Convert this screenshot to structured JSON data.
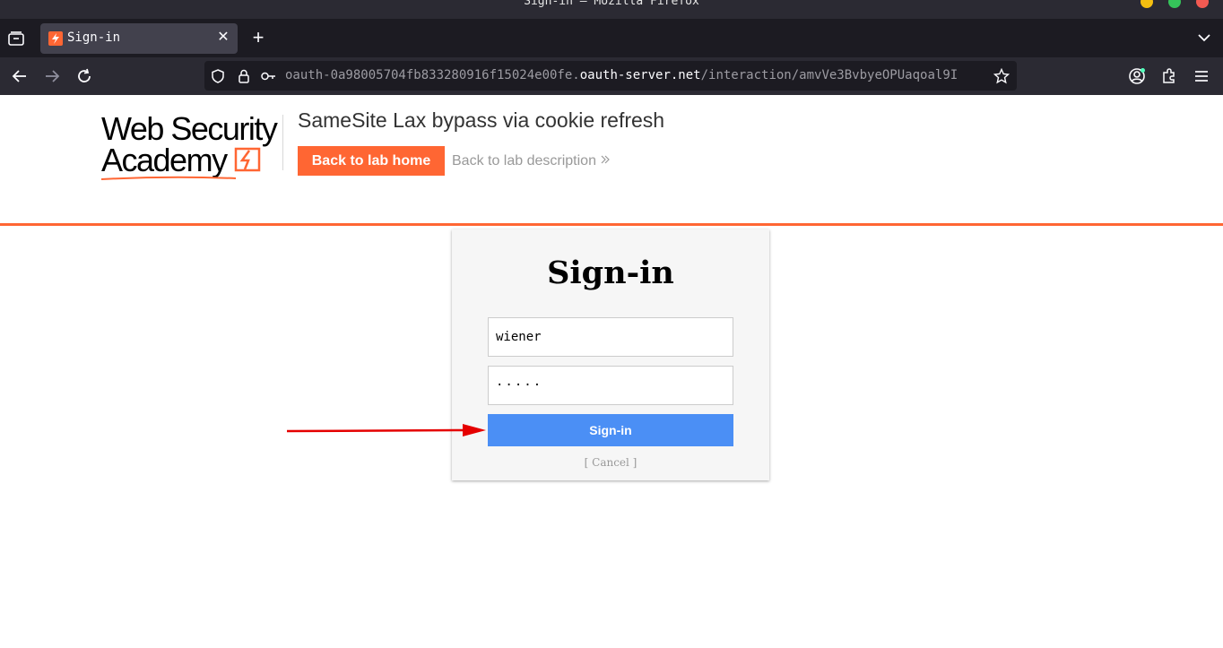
{
  "window": {
    "title": "Sign-in — Mozilla Firefox"
  },
  "tabs": [
    {
      "title": "Sign-in",
      "icon": "lightning-favicon-icon",
      "active": true
    }
  ],
  "urlbar": {
    "url_prefix": "oauth-0a98005704fb833280916f15024e00fe.",
    "url_domain": "oauth-server.net",
    "url_path": "/interaction/amvVe3BvbyeOPUaqoal9I"
  },
  "header": {
    "logo_line1": "Web Security",
    "logo_line2": "Academy",
    "lab_title": "SameSite Lax bypass via cookie refresh",
    "back_home_label": "Back to lab home",
    "back_description_label": "Back to lab description",
    "accent_color": "#ff6633"
  },
  "login": {
    "heading": "Sign-in",
    "username_value": "wiener",
    "password_value": "·····",
    "submit_label": "Sign-in",
    "cancel_label": "[ Cancel ]",
    "button_color": "#4b8ff5"
  },
  "annotation": {
    "arrow_color": "#e50000"
  }
}
